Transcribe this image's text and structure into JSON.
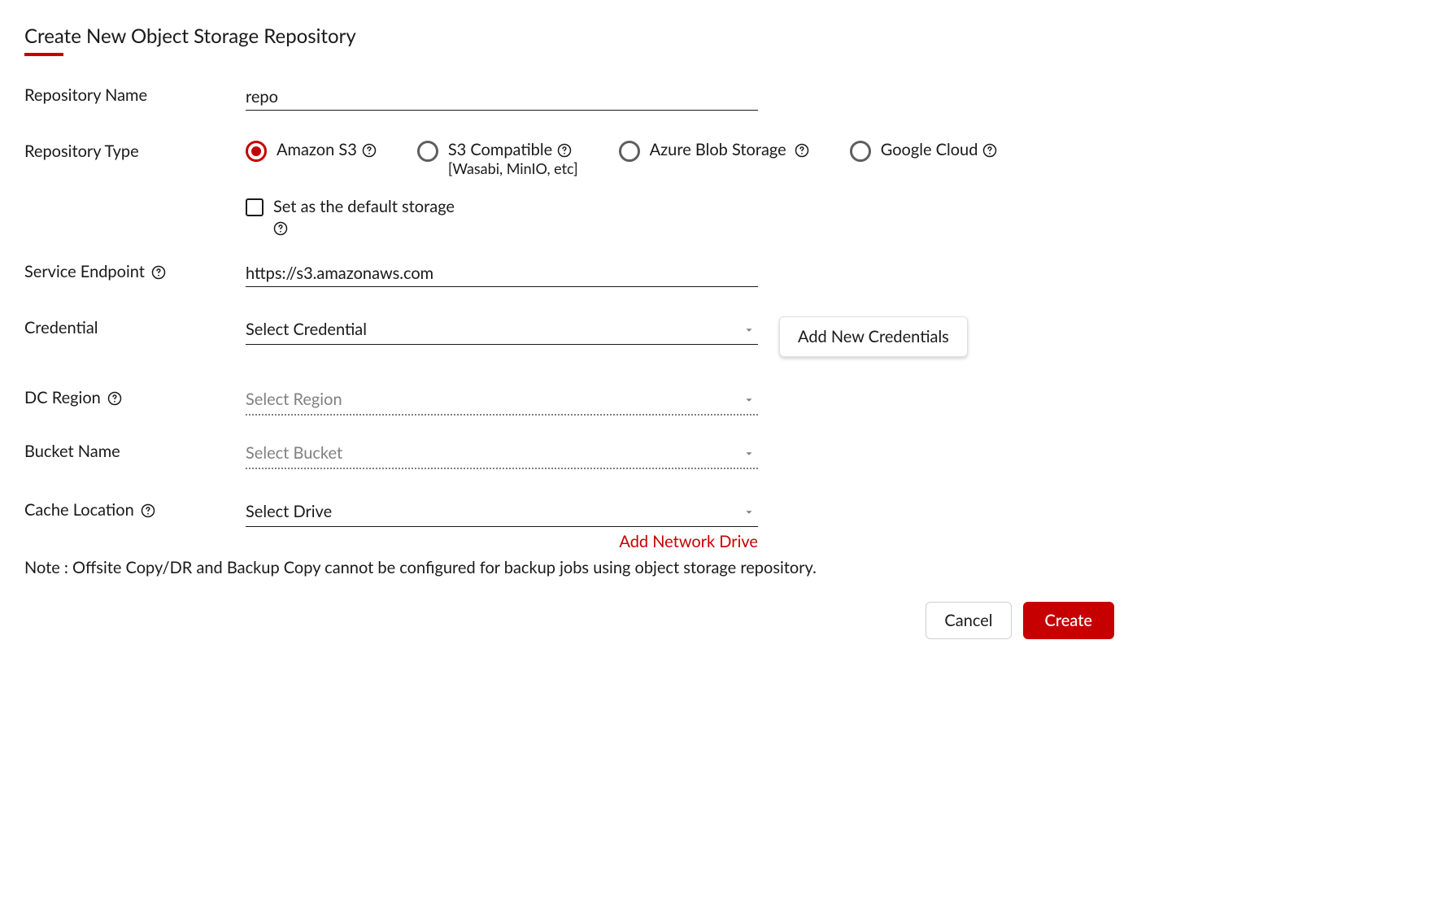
{
  "title": "Create New Object Storage Repository",
  "labels": {
    "repository_name": "Repository Name",
    "repository_type": "Repository Type",
    "service_endpoint": "Service Endpoint",
    "credential": "Credential",
    "dc_region": "DC Region",
    "bucket_name": "Bucket Name",
    "cache_location": "Cache Location"
  },
  "fields": {
    "repository_name_value": "repo",
    "service_endpoint_value": "https://s3.amazonaws.com",
    "credential_value": "Select Credential",
    "dc_region_placeholder": "Select Region",
    "bucket_name_placeholder": "Select Bucket",
    "cache_location_value": "Select Drive"
  },
  "repository_types": {
    "option1": {
      "label": "Amazon S3",
      "selected": true
    },
    "option2": {
      "label": "S3 Compatible",
      "sub": "[Wasabi, MinIO, etc]",
      "selected": false
    },
    "option3": {
      "label": "Azure Blob Storage",
      "selected": false
    },
    "option4": {
      "label": "Google Cloud",
      "selected": false
    }
  },
  "default_storage": {
    "label": "Set as the default storage",
    "checked": false
  },
  "buttons": {
    "add_credentials": "Add New Credentials",
    "add_network_drive": "Add Network Drive",
    "cancel": "Cancel",
    "create": "Create"
  },
  "note": "Note : Offsite Copy/DR and Backup Copy cannot be configured for backup jobs using object storage repository."
}
